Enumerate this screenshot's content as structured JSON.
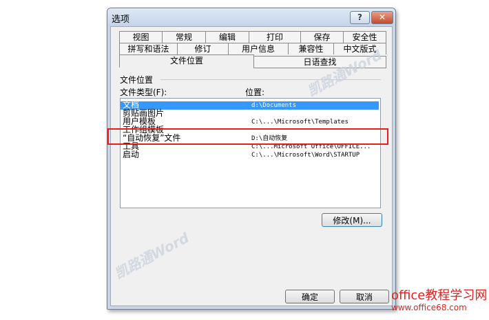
{
  "window": {
    "title": "选项",
    "help_label": "?",
    "close_label": "✕"
  },
  "tabs_row1": [
    "视图",
    "常规",
    "编辑",
    "打印",
    "保存",
    "安全性"
  ],
  "tabs_row2": [
    "拼写和语法",
    "修订",
    "用户信息",
    "兼容性",
    "中文版式"
  ],
  "tabs_row3": [
    "文件位置",
    "日语查找"
  ],
  "section_title": "文件位置",
  "list": {
    "type_header": "文件类型(F):",
    "location_header": "位置:",
    "rows": [
      {
        "type": "文档",
        "location": "d:\\Documents",
        "selected": true
      },
      {
        "type": "剪贴画图片",
        "location": ""
      },
      {
        "type": "用户模板",
        "location": "C:\\...\\Microsoft\\Templates"
      },
      {
        "type": "工作组模板",
        "location": ""
      },
      {
        "type": "“自动恢复”文件",
        "location": "D:\\自动恢复"
      },
      {
        "type": "工具",
        "location": "C:\\...Microsoft Office\\OFFICE..."
      },
      {
        "type": "启动",
        "location": "C:\\...\\Microsoft\\Word\\STARTUP"
      }
    ]
  },
  "buttons": {
    "modify": "修改(M)...",
    "ok": "确定",
    "cancel": "取消"
  },
  "watermarks": {
    "top": "凯路通Word",
    "bottom": "凯路通Word"
  },
  "site": {
    "name": "office教程学习网",
    "url": "www.office68.com"
  },
  "colors": {
    "highlight_box": "#e02020",
    "selection": "#3399ff",
    "site_text": "#e0231c"
  }
}
